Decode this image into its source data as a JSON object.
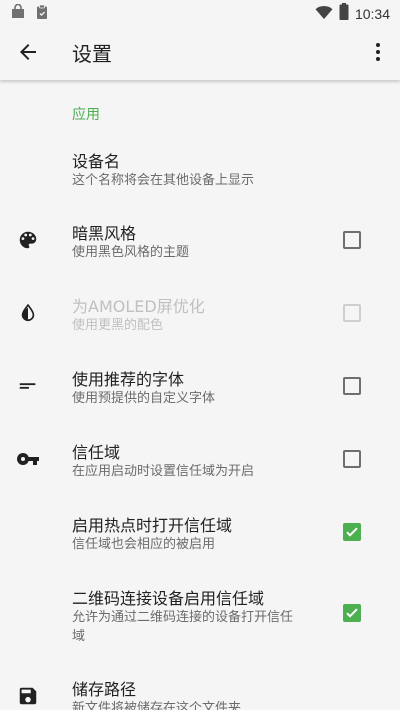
{
  "status_bar": {
    "time": "10:34",
    "icons": [
      "bag-icon",
      "clipboard-icon",
      "wifi-icon",
      "battery-icon"
    ]
  },
  "app_bar": {
    "title": "设置",
    "icons": [
      "arrow-back-icon",
      "more-vert-icon"
    ]
  },
  "section": {
    "header": "应用"
  },
  "prefs": [
    {
      "title": "设备名",
      "summary": "这个名称将会在其他设备上显示"
    },
    {
      "title": "暗黑风格",
      "summary": "使用黑色风格的主题",
      "icon": "palette-icon",
      "checked": false
    },
    {
      "title": "为AMOLED屏优化",
      "summary": "使用更黑的配色",
      "icon": "contrast-icon",
      "checked": false,
      "enabled": false
    },
    {
      "title": "使用推荐的字体",
      "summary": "使用预提供的自定义字体",
      "icon": "short-text-icon",
      "checked": false
    },
    {
      "title": "信任域",
      "summary": "在应用启动时设置信任域为开启",
      "icon": "key-icon",
      "checked": false
    },
    {
      "title": "启用热点时打开信任域",
      "summary": "信任域也会相应的被启用",
      "checked": true
    },
    {
      "title": "二维码连接设备启用信任域",
      "summary_line1": "允许为通过二维码连接的设备打开信任",
      "summary_line2": "域",
      "checked": true
    },
    {
      "title": "储存路径",
      "summary": "新文件将被储存在这个文件夹",
      "icon": "save-icon"
    }
  ],
  "colors": {
    "accent": "#4caf50",
    "background": "#f5f5f5",
    "text_primary": "#212121",
    "text_secondary": "#6b6b6b",
    "disabled": "#c0c0c0"
  }
}
